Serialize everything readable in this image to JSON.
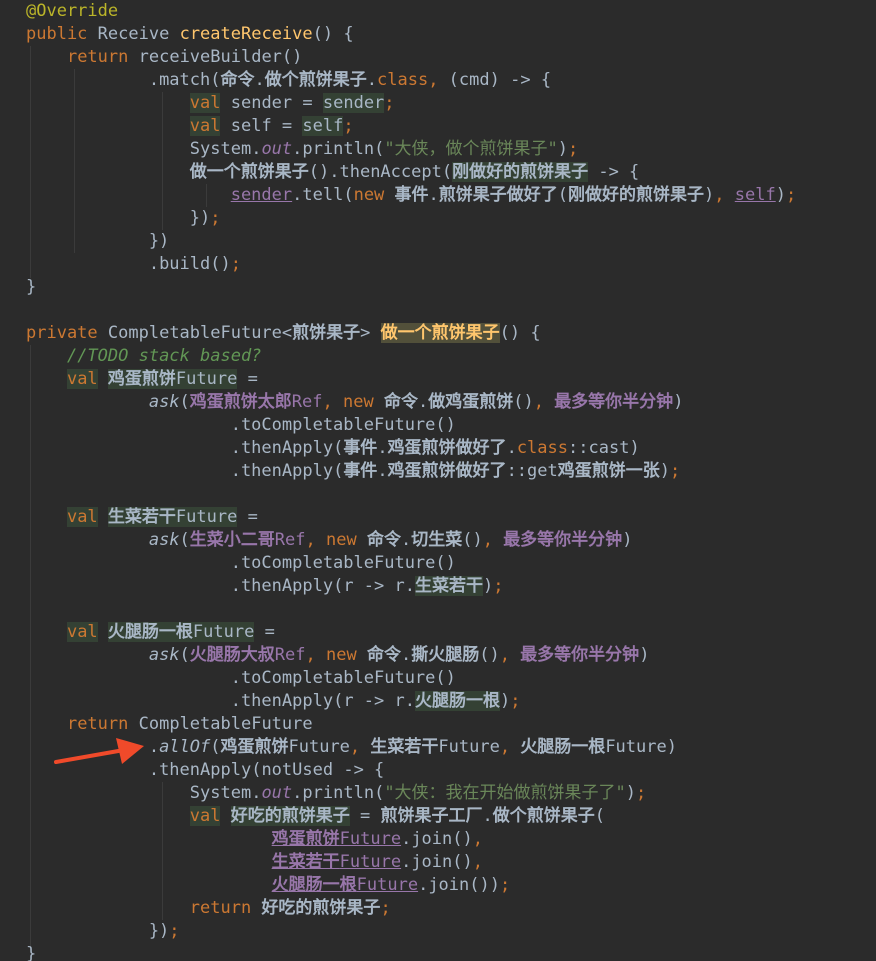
{
  "editor": {
    "theme_colors": {
      "background": "#2b2b2b",
      "keyword": "#cc7832",
      "annotation": "#bbb529",
      "method_declaration": "#ffc66d",
      "string": "#6a8759",
      "comment": "#629755",
      "field": "#9876aa",
      "default_text": "#a9b7c6",
      "arrow_annotation": "#f04a2a"
    },
    "code": {
      "annotation": "@Override",
      "kw_public": "public",
      "kw_private": "private",
      "kw_return": "return",
      "kw_val": "val",
      "kw_new": "new",
      "kw_class": "class",
      "type_receive": "Receive",
      "type_completable_future": "CompletableFuture",
      "m_create_receive": "createReceive",
      "m_receive_builder": "receiveBuilder",
      "m_match": "match",
      "m_build": "build",
      "m_println": "println",
      "m_then_accept": "thenAccept",
      "m_tell": "tell",
      "m_ask": "ask",
      "m_to_completable_future": "toCompletableFuture",
      "m_then_apply": "thenApply",
      "m_cast": "cast",
      "m_get": "get",
      "m_all_of": "allOf",
      "m_join": "join",
      "system": "System",
      "out": "out",
      "id_cmd": "cmd",
      "id_sender": "sender",
      "id_self": "self",
      "id_r": "r",
      "id_not_used": "notUsed",
      "suffix_future": "Future",
      "suffix_ref": "Ref",
      "cn_command": "命令",
      "cn_make_pancake": "做个煎饼果子",
      "cn_make_one_pancake": "做一个煎饼果子",
      "cn_freshly_made": "刚做好的煎饼果子",
      "cn_event": "事件",
      "cn_pancake_done": "煎饼果子做好了",
      "cn_pancake": "煎饼果子",
      "cn_egg_pancake": "鸡蛋煎饼",
      "cn_egg_pancake_taro": "鸡蛋煎饼太郎",
      "cn_make_egg_pancake": "做鸡蛋煎饼",
      "cn_wait_half_minute": "最多等你半分钟",
      "cn_egg_pancake_done": "鸡蛋煎饼做好了",
      "cn_one_egg_pancake": "鸡蛋煎饼一张",
      "cn_lettuce": "生菜若干",
      "cn_lettuce_brother": "生菜小二哥",
      "cn_cut_lettuce": "切生菜",
      "cn_ham": "火腿肠一根",
      "cn_ham_uncle": "火腿肠大叔",
      "cn_tear_ham": "撕火腿肠",
      "cn_tasty_pancake": "好吃的煎饼果子",
      "cn_pancake_factory": "煎饼果子工厂",
      "str_hero_make": "\"大侠，做个煎饼果子\"",
      "str_hero_start": "\"大侠：我在开始做煎饼果子了\"",
      "comment_todo": "//TODO stack based?"
    }
  }
}
